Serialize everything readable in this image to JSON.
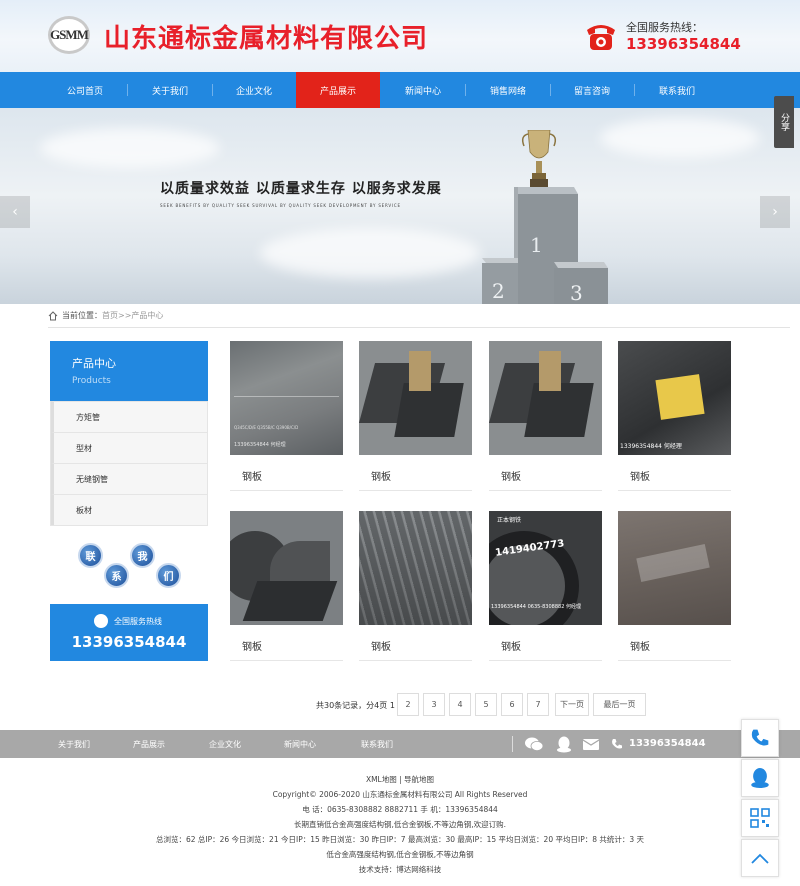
{
  "header": {
    "logo_text": "GSMM",
    "company_name": "山东通标金属材料有限公司",
    "hotline_label": "全国服务热线：",
    "hotline_number": "13396354844"
  },
  "nav": {
    "items": [
      "公司首页",
      "关于我们",
      "企业文化",
      "产品展示",
      "新闻中心",
      "销售网络",
      "留言咨询",
      "联系我们"
    ],
    "active_index": 3
  },
  "banner": {
    "slogan": "以质量求效益  以质量求生存  以服务求发展",
    "subtitle": "SEEK BENEFITS BY QUALITY SEEK SURVIVAL BY QUALITY SEEK DEVELOPMENT BY SERVICE",
    "podium_numbers": [
      "1",
      "2",
      "3"
    ],
    "prev_arrow": "‹",
    "next_arrow": "›"
  },
  "share_tab": "分享",
  "breadcrumb": {
    "label": "当前位置：",
    "home": "首页",
    "separator": ">>",
    "current": "产品中心"
  },
  "sidebar": {
    "title": "产品中心",
    "subtitle": "Products",
    "items": [
      "方矩管",
      "型材",
      "无缝钢管",
      "板材"
    ],
    "contact_badges": [
      "联",
      "系",
      "我",
      "们"
    ],
    "hotline_label": "全国服务热线",
    "hotline_number": "13396354844"
  },
  "products": [
    {
      "title": "钢板"
    },
    {
      "title": "钢板"
    },
    {
      "title": "钢板"
    },
    {
      "title": "钢板"
    },
    {
      "title": "钢板"
    },
    {
      "title": "钢板"
    },
    {
      "title": "钢板"
    },
    {
      "title": "钢板"
    }
  ],
  "product_image_text": {
    "p1_stamp": "13396354844 何经理",
    "p1_stencil": "Q345C/D/E Q355B/C Q390B/C/D",
    "p4_note": "13396354844 何经理",
    "p7_top": "正本钢铁",
    "p7_mid": "1419402773",
    "p7_bottom": "13396354844 0635-8308882 何经理"
  },
  "pagination": {
    "info": "共30条记录，分4页",
    "current": "1",
    "pages": [
      "2",
      "3",
      "4",
      "5",
      "6",
      "7"
    ],
    "next": "下一页",
    "last": "最后一页"
  },
  "footer_nav": {
    "items": [
      "关于我们",
      "产品展示",
      "企业文化",
      "新闻中心",
      "联系我们"
    ],
    "phone": "13396354844"
  },
  "footer_info": {
    "line1": "XML地图 | 导航地图",
    "line2": "Copyright© 2006-2020 山东通标金属材料有限公司 All Rights Reserved",
    "line3": "电 话：0635-8308882 8882711 手 机：13396354844",
    "line4": "长期直销低合金高强度结构钢,低合金钢板,不等边角钢,欢迎订购.",
    "line5": "总浏览：62 总IP：26 今日浏览：21 今日IP：15 昨日浏览：30 昨日IP：7 最高浏览：30 最高IP：15 平均日浏览：20 平均日IP：8 共统计：3 天",
    "line6": "低合金高强度结构钢,低合金钢板,不等边角钢",
    "line7": "技术支持：博达网络科技"
  },
  "colors": {
    "brand_blue": "#2288e0",
    "brand_red": "#e2231a",
    "footer_gray": "#a8a8a8"
  }
}
